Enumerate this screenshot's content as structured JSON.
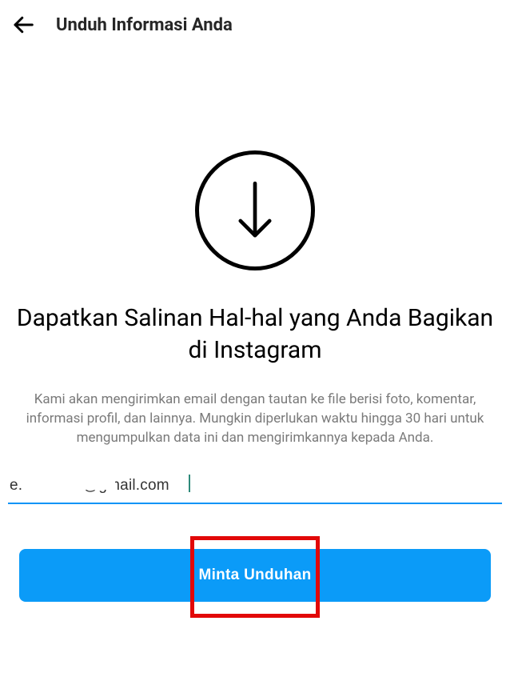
{
  "header": {
    "title": "Unduh Informasi Anda"
  },
  "main": {
    "heading": "Dapatkan Salinan Hal-hal yang Anda Bagikan di Instagram",
    "description": "Kami akan mengirimkan email dengan tautan ke file berisi foto, komentar, informasi profil, dan lainnya. Mungkin diperlukan waktu hingga 30 hari untuk mengumpulkan data ini dan mengirimkannya kepada Anda."
  },
  "email": {
    "value": "e..............i@gmail.com"
  },
  "cta": {
    "label": "Minta Unduhan"
  },
  "colors": {
    "primary": "#0b9bf8",
    "underline": "#0b94f7",
    "highlight": "#e20808"
  }
}
